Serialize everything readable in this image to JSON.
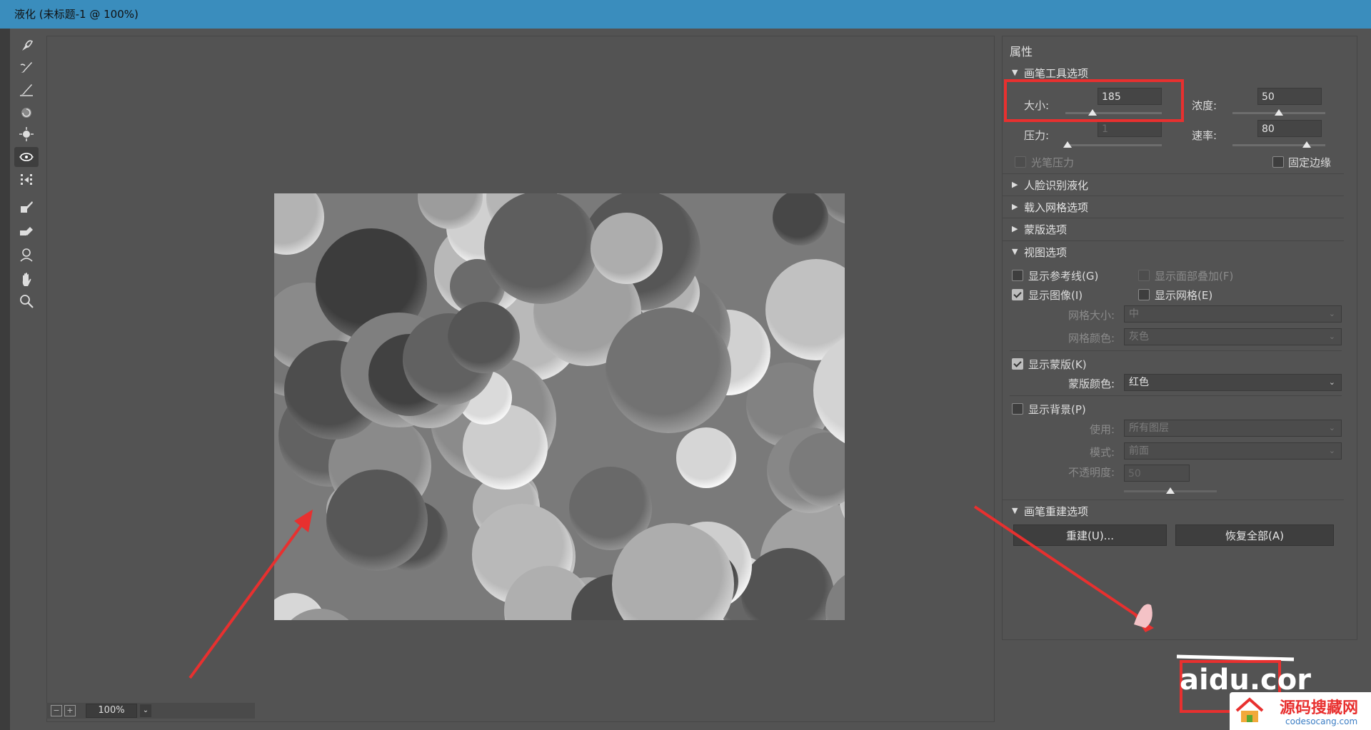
{
  "window": {
    "title": "液化 (未标题-1 @ 100%)"
  },
  "statusbar": {
    "zoom": "100%"
  },
  "panel": {
    "title": "属性",
    "brush_tool_options": {
      "header": "画笔工具选项",
      "size_label": "大小:",
      "size_value": "185",
      "size_level": 0.28,
      "density_label": "浓度:",
      "density_value": "50",
      "density_level": 0.5,
      "pressure_label": "压力:",
      "pressure_value": "1",
      "pressure_level": 0.02,
      "rate_label": "速率:",
      "rate_value": "80",
      "rate_level": 0.8,
      "stylus_pressure_label": "光笔压力",
      "pin_edges_label": "固定边缘"
    },
    "sections": {
      "face_aware": "人脸识别液化",
      "load_mesh": "载入网格选项",
      "mask": "蒙版选项",
      "view": "视图选项",
      "brush_reconstruct": "画笔重建选项"
    },
    "view_options": {
      "show_guides": "显示参考线(G)",
      "show_face_overlay": "显示面部叠加(F)",
      "show_image": "显示图像(I)",
      "show_mesh": "显示网格(E)",
      "mesh_size_label": "网格大小:",
      "mesh_size_value": "中",
      "mesh_color_label": "网格颜色:",
      "mesh_color_value": "灰色",
      "show_mask": "显示蒙版(K)",
      "mask_color_label": "蒙版颜色:",
      "mask_color_value": "红色",
      "show_backdrop": "显示背景(P)",
      "use_label": "使用:",
      "use_value": "所有图层",
      "mode_label": "模式:",
      "mode_value": "前面",
      "opacity_label": "不透明度:",
      "opacity_value": "50",
      "opacity_level": 0.5
    },
    "reconstruct_button": "重建(U)...",
    "restore_all_button": "恢复全部(A)"
  },
  "overlay": {
    "watermark_text": "aidu.cor",
    "site_logo_text": "源码搜藏网",
    "site_url": "codesocang.com",
    "highlight_color": "#e8302f"
  }
}
